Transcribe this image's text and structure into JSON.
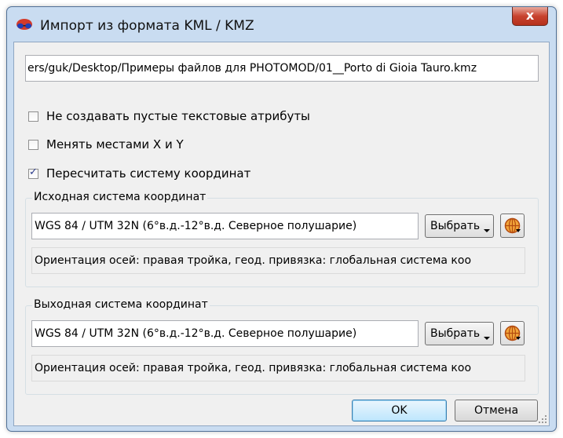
{
  "window": {
    "title": "Импорт из формата KML / KMZ",
    "close_label": "x"
  },
  "path": {
    "value": "ers/guk/Desktop/Примеры файлов для PHOTOMOD/01__Porto di Gioia Tauro.kmz"
  },
  "options": [
    {
      "label": "Не создавать пустые текстовые атрибуты",
      "checked": false
    },
    {
      "label": "Менять местами X и Y",
      "checked": false
    },
    {
      "label": "Пересчитать систему координат",
      "checked": true
    }
  ],
  "source_cs": {
    "label": "Исходная система координат",
    "value": "WGS 84 / UTM 32N (6°в.д.-12°в.д. Северное полушарие)",
    "choose_label": "Выбрать",
    "info": "Ориентация осей: правая тройка, геод. привязка: глобальная система коо"
  },
  "target_cs": {
    "label": "Выходная система координат",
    "value": "WGS 84 / UTM 32N (6°в.д.-12°в.д. Северное полушарие)",
    "choose_label": "Выбрать",
    "info": "Ориентация осей: правая тройка, геод. привязка: глобальная система коо"
  },
  "buttons": {
    "ok": "OK",
    "cancel": "Отмена"
  }
}
